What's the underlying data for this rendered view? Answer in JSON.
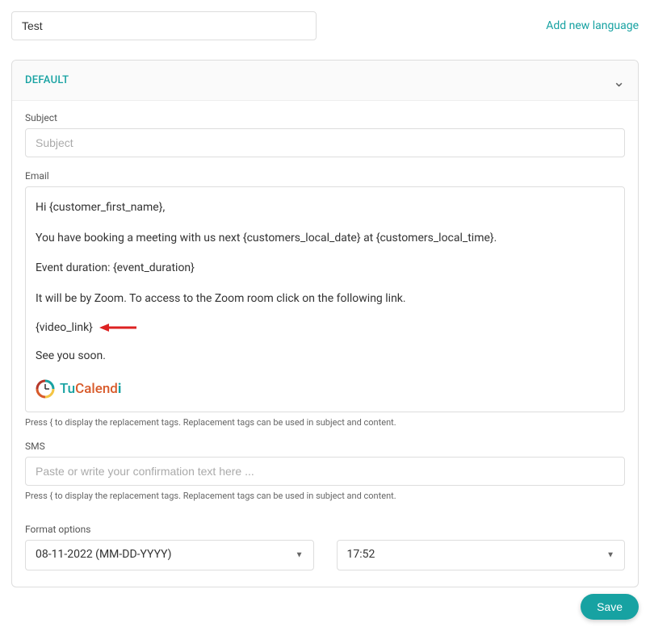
{
  "top": {
    "test_value": "Test",
    "add_language": "Add new language"
  },
  "panel": {
    "title": "DEFAULT"
  },
  "subject": {
    "label": "Subject",
    "placeholder": "Subject",
    "value": ""
  },
  "email": {
    "label": "Email",
    "line1": "Hi  {customer_first_name},",
    "line2": "You have booking a meeting with us next {customers_local_date} at {customers_local_time}.",
    "line3": "Event duration: {event_duration}",
    "line4": "It will be by Zoom. To access to the Zoom room click on the following link.",
    "video_link": "{video_link}",
    "line5": "See you soon.",
    "logo_tu": "Tu",
    "logo_calend": "Calend",
    "logo_i": "i",
    "hint": "Press { to display the replacement tags. Replacement tags can be used in subject and content."
  },
  "sms": {
    "label": "SMS",
    "placeholder": "Paste or write your confirmation text here ...",
    "hint": "Press { to display the replacement tags. Replacement tags can be used in subject and content."
  },
  "format": {
    "label": "Format options",
    "date_value": "08-11-2022 (MM-DD-YYYY)",
    "time_value": "17:52"
  },
  "save": {
    "label": "Save"
  }
}
